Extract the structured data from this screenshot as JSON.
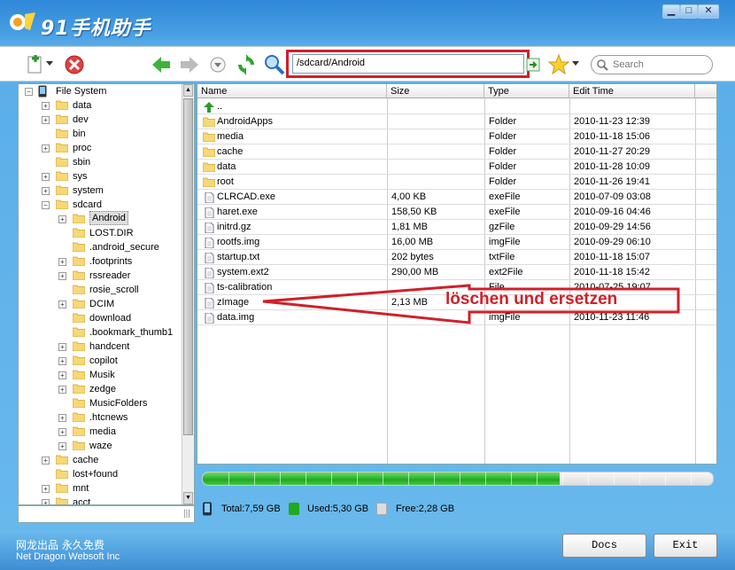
{
  "app": {
    "title": "91手机助手"
  },
  "window_buttons": {
    "minimize": "▁",
    "maximize": "□",
    "close": "✕"
  },
  "toolbar": {
    "address": "/sdcard/Android",
    "search_placeholder": "Search"
  },
  "tree": {
    "root": "File System",
    "items": [
      {
        "label": "data",
        "level": 1,
        "exp": "+"
      },
      {
        "label": "dev",
        "level": 1,
        "exp": "+"
      },
      {
        "label": "bin",
        "level": 1,
        "exp": ""
      },
      {
        "label": "proc",
        "level": 1,
        "exp": "+"
      },
      {
        "label": "sbin",
        "level": 1,
        "exp": ""
      },
      {
        "label": "sys",
        "level": 1,
        "exp": "+"
      },
      {
        "label": "system",
        "level": 1,
        "exp": "+"
      },
      {
        "label": "sdcard",
        "level": 1,
        "exp": "−"
      },
      {
        "label": "Android",
        "level": 2,
        "exp": "+",
        "selected": true
      },
      {
        "label": "LOST.DIR",
        "level": 2,
        "exp": ""
      },
      {
        "label": ".android_secure",
        "level": 2,
        "exp": ""
      },
      {
        "label": ".footprints",
        "level": 2,
        "exp": "+"
      },
      {
        "label": "rssreader",
        "level": 2,
        "exp": "+"
      },
      {
        "label": "rosie_scroll",
        "level": 2,
        "exp": ""
      },
      {
        "label": "DCIM",
        "level": 2,
        "exp": "+"
      },
      {
        "label": "download",
        "level": 2,
        "exp": ""
      },
      {
        "label": ".bookmark_thumb1",
        "level": 2,
        "exp": ""
      },
      {
        "label": "handcent",
        "level": 2,
        "exp": "+"
      },
      {
        "label": "copilot",
        "level": 2,
        "exp": "+"
      },
      {
        "label": "Musik",
        "level": 2,
        "exp": "+"
      },
      {
        "label": "zedge",
        "level": 2,
        "exp": "+"
      },
      {
        "label": "MusicFolders",
        "level": 2,
        "exp": ""
      },
      {
        "label": ".htcnews",
        "level": 2,
        "exp": "+"
      },
      {
        "label": "media",
        "level": 2,
        "exp": "+"
      },
      {
        "label": "waze",
        "level": 2,
        "exp": "+"
      },
      {
        "label": "cache",
        "level": 1,
        "exp": "+"
      },
      {
        "label": "lost+found",
        "level": 1,
        "exp": ""
      },
      {
        "label": "mnt",
        "level": 1,
        "exp": "+"
      },
      {
        "label": "acct",
        "level": 1,
        "exp": "+"
      }
    ]
  },
  "files": {
    "columns": [
      "Name",
      "Size",
      "Type",
      "Edit Time"
    ],
    "up": "..",
    "rows": [
      {
        "name": "AndroidApps",
        "size": "",
        "type": "Folder",
        "time": "2010-11-23 12:39",
        "kind": "folder"
      },
      {
        "name": "media",
        "size": "",
        "type": "Folder",
        "time": "2010-11-18 15:06",
        "kind": "folder"
      },
      {
        "name": "cache",
        "size": "",
        "type": "Folder",
        "time": "2010-11-27 20:29",
        "kind": "folder"
      },
      {
        "name": "data",
        "size": "",
        "type": "Folder",
        "time": "2010-11-28 10:09",
        "kind": "folder"
      },
      {
        "name": "root",
        "size": "",
        "type": "Folder",
        "time": "2010-11-26 19:41",
        "kind": "folder"
      },
      {
        "name": "CLRCAD.exe",
        "size": "4,00 KB",
        "type": "exeFile",
        "time": "2010-07-09 03:08",
        "kind": "file"
      },
      {
        "name": "haret.exe",
        "size": "158,50 KB",
        "type": "exeFile",
        "time": "2010-09-16 04:46",
        "kind": "file"
      },
      {
        "name": "initrd.gz",
        "size": "1,81 MB",
        "type": "gzFile",
        "time": "2010-09-29 14:56",
        "kind": "file"
      },
      {
        "name": "rootfs.img",
        "size": "16,00 MB",
        "type": "imgFile",
        "time": "2010-09-29 06:10",
        "kind": "file"
      },
      {
        "name": "startup.txt",
        "size": "202 bytes",
        "type": "txtFile",
        "time": "2010-11-18 15:07",
        "kind": "file"
      },
      {
        "name": "system.ext2",
        "size": "290,00 MB",
        "type": "ext2File",
        "time": "2010-11-18 15:42",
        "kind": "file"
      },
      {
        "name": "ts-calibration",
        "size": "",
        "type": "File",
        "time": "2010-07-25 19:07",
        "kind": "file"
      },
      {
        "name": "zImage",
        "size": "2,13 MB",
        "type": "",
        "time": "",
        "kind": "file"
      },
      {
        "name": "data.img",
        "size": "",
        "type": "imgFile",
        "time": "2010-11-23 11:46",
        "kind": "file"
      }
    ]
  },
  "storage": {
    "used_fraction": 0.7,
    "total": "Total:7,59 GB",
    "used": "Used:5,30 GB",
    "free": "Free:2,28 GB"
  },
  "annotation": {
    "text": "löschen und ersetzen"
  },
  "footer": {
    "cn": "网龙出品 永久免费",
    "en": "Net Dragon Websoft Inc",
    "docs": "Docs",
    "exit": "Exit"
  },
  "colors": {
    "highlight": "#d0202a",
    "used": "#1faa1f",
    "title_bg": "#2f88d8"
  }
}
